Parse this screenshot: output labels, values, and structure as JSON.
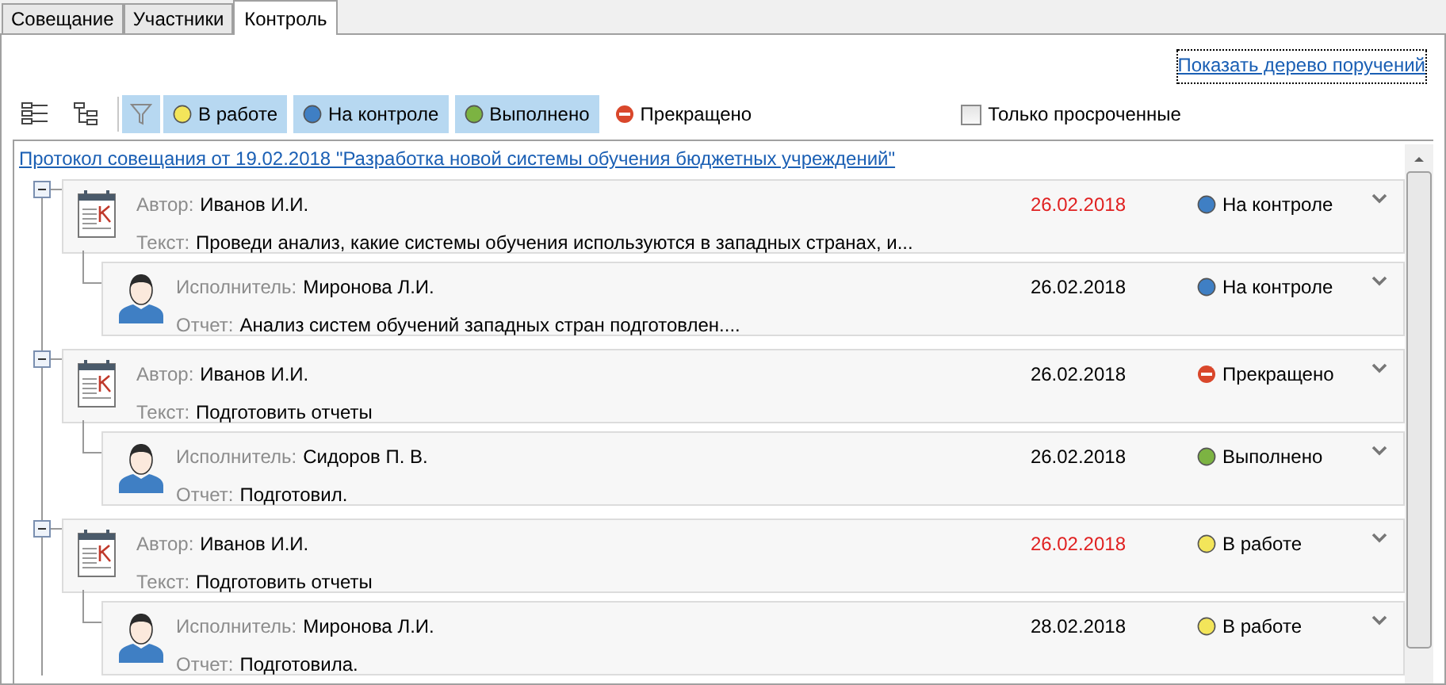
{
  "tabs": [
    {
      "label": "Совещание",
      "selected": false
    },
    {
      "label": "Участники",
      "selected": false
    },
    {
      "label": "Контроль",
      "selected": true
    }
  ],
  "tree_link": "Показать дерево поручений",
  "toolbar": {
    "filter_selected": true,
    "filters": [
      {
        "label": "В работе",
        "kind": "in_work",
        "selected": true
      },
      {
        "label": "На контроле",
        "kind": "control",
        "selected": true
      },
      {
        "label": "Выполнено",
        "kind": "done",
        "selected": true
      },
      {
        "label": "Прекращено",
        "kind": "stopped",
        "selected": false
      }
    ],
    "overdue_only": {
      "label": "Только просроченные",
      "checked": false
    }
  },
  "meeting_link": "Протокол совещания от 19.02.2018 \"Разработка новой системы обучения бюджетных учреждений\"",
  "tasks": [
    {
      "expanded": true,
      "author_label": "Автор:",
      "author": "Иванов И.И.",
      "text_label": "Текст:",
      "text": "Проведи анализ, какие системы обучения используются в западных странах, и...",
      "date": "26.02.2018",
      "overdue": true,
      "status": {
        "label": "На контроле",
        "kind": "control"
      },
      "children": [
        {
          "executor_label": "Исполнитель:",
          "executor": "Миронова Л.И.",
          "report_label": "Отчет:",
          "report": "Анализ систем обучений западных стран подготовлен....",
          "date": "26.02.2018",
          "overdue": false,
          "status": {
            "label": "На контроле",
            "kind": "control"
          }
        }
      ]
    },
    {
      "expanded": true,
      "author_label": "Автор:",
      "author": "Иванов И.И.",
      "text_label": "Текст:",
      "text": "Подготовить отчеты",
      "date": "26.02.2018",
      "overdue": false,
      "status": {
        "label": "Прекращено",
        "kind": "stopped"
      },
      "children": [
        {
          "executor_label": "Исполнитель:",
          "executor": "Сидоров П. В.",
          "report_label": "Отчет:",
          "report": "Подготовил.",
          "date": "26.02.2018",
          "overdue": false,
          "status": {
            "label": "Выполнено",
            "kind": "done"
          }
        }
      ]
    },
    {
      "expanded": true,
      "author_label": "Автор:",
      "author": "Иванов И.И.",
      "text_label": "Текст:",
      "text": "Подготовить отчеты",
      "date": "26.02.2018",
      "overdue": true,
      "status": {
        "label": "В работе",
        "kind": "in_work"
      },
      "children": [
        {
          "executor_label": "Исполнитель:",
          "executor": "Миронова Л.И.",
          "report_label": "Отчет:",
          "report": "Подготовила.",
          "date": "28.02.2018",
          "overdue": false,
          "status": {
            "label": "В работе",
            "kind": "in_work"
          }
        }
      ]
    }
  ]
}
